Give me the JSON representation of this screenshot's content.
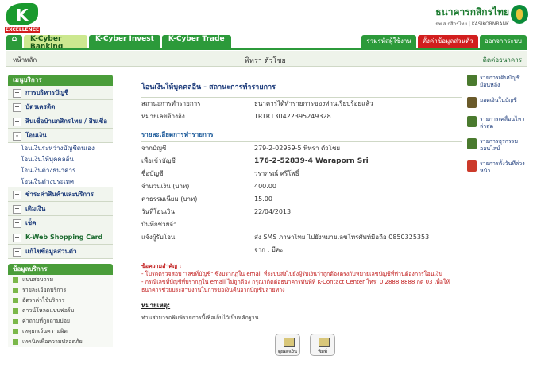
{
  "header": {
    "logo_text": "K",
    "logo_sub": "EXCELLENCE",
    "bank_th": "ธนาคารกสิกรไทย",
    "bank_en": "ธพ.ส.กสิกรไทย | KASIKORNBANK"
  },
  "tabs": [
    {
      "label": "⌂"
    },
    {
      "label": "K-Cyber Banking"
    },
    {
      "label": "K-Cyber Invest"
    },
    {
      "label": "K-Cyber Trade"
    }
  ],
  "rtabs": [
    {
      "label": "รวมรหัสผู้ใช้งาน"
    },
    {
      "label": "ตั้งค่าข้อมูลส่วนตัว"
    },
    {
      "label": "ออกจากระบบ"
    }
  ],
  "subbar": {
    "home": "หน้าหลัก",
    "name": "พิทรา ตัวโชย",
    "contact": "ติดต่อธนาคาร"
  },
  "sidebar": {
    "head": "เมนูบริการ",
    "items": [
      {
        "label": "การบริหารบัญชี"
      },
      {
        "label": "บัตรเครดิต"
      },
      {
        "label": "สินเชื่อบ้านกสิกรไทย / สินเชื่ออื่นๆ"
      },
      {
        "label": "โอนเงิน"
      }
    ],
    "sub": [
      {
        "label": "โอนเงินระหว่างบัญชีตนเอง"
      },
      {
        "label": "โอนเงินให้บุคคลอื่น"
      },
      {
        "label": "โอนเงินต่างธนาคาร"
      },
      {
        "label": "โอนเงินต่างประเทศ"
      }
    ],
    "items2": [
      {
        "label": "ชำระค่าสินค้าและบริการ"
      },
      {
        "label": "เติมเงิน"
      },
      {
        "label": "เช็ค"
      },
      {
        "label": "K-Web Shopping Card"
      },
      {
        "label": "แก้ไขข้อมูลส่วนตัว"
      }
    ],
    "tools_head": "ข้อมูลบริการ",
    "tools": [
      {
        "label": "แบบสอบถาม"
      },
      {
        "label": "รายละเอียดบริการ"
      },
      {
        "label": "อัตราค่าใช้บริการ"
      },
      {
        "label": "ดาวน์โหลดแบบฟอร์ม"
      },
      {
        "label": "คำถามที่ถูกถามบ่อย"
      },
      {
        "label": "เหตุยกเว้นความผิด"
      },
      {
        "label": "เทคนิคเพื่อความปลอดภัย"
      }
    ]
  },
  "main": {
    "title": "โอนเงินให้บุคคลอื่น - สถานะการทำรายการ",
    "status_label": "สถานะการทำรายการ",
    "status_value": "ธนาคารได้ทำรายการของท่านเรียบร้อยแล้ว",
    "ref_label": "หมายเลขอ้างอิง",
    "ref_value": "TRTR130422395249328",
    "detail_head": "รายละเอียดการทำรายการ",
    "rows": [
      {
        "k": "จากบัญชี",
        "v": "279-2-02959-5 พิทรา ตัวโชย"
      },
      {
        "k": "เพื่อเข้าบัญชี",
        "v": "176-2-52839-4 Waraporn    Sri"
      },
      {
        "k": "ชื่อบัญชี",
        "v": "วราภรณ์ ศรีโพธิ์"
      },
      {
        "k": "จำนวนเงิน (บาท)",
        "v": "400.00"
      },
      {
        "k": "ค่าธรรมเนียม (บาท)",
        "v": "15.00"
      },
      {
        "k": "วันที่โอนเงิน",
        "v": "22/04/2013"
      },
      {
        "k": "บันทึกช่วยจำ",
        "v": ""
      },
      {
        "k": "แจ้งผู้รับโอน",
        "v": "ส่ง SMS ภาษาไทย ไปยังหมายเลขโทรศัพท์มือถือ 0850325353"
      },
      {
        "k": "",
        "v": "จาก : บีคะ"
      }
    ],
    "note_head": "ข้อความสำคัญ :",
    "note_1": "- โปรดตรวจสอบ \"เลขที่บัญชี\" ซึ่งปรากฏใน email ที่ระบบส่งไปยังผู้รับเงินว่าถูกต้องตรงกับหมายเลขบัญชีที่ท่านต้องการโอนเงิน",
    "note_2": "- กรณีเลขที่บัญชีที่ปรากฏใน email ไม่ถูกต้อง กรุณาติดต่อธนาคารทันทีที่ K-Contact Center โทร. 0 2888 8888 กด 03 เพื่อให้ธนาคารช่วยประสานงานในการขอเงินคืนจากบัญชีปลายทาง",
    "remark_head": "หมายเหตุ:",
    "remark_text": "ท่านสามารถพิมพ์รายการนี้เพื่อเก็บไว้เป็นหลักฐาน"
  },
  "buttons": {
    "save": "ดูยอดเงิน",
    "print": "พิมพ์"
  },
  "rightcol": [
    {
      "label": "รายการเดินบัญชีย้อนหลัง"
    },
    {
      "label": "ยอดเงินในบัญชี"
    },
    {
      "label": "รายการเคลื่อนไหวล่าสุด"
    },
    {
      "label": "รายการธุรกรรมออนไลน์"
    },
    {
      "label": "รายการตั้งวันที่ล่วงหน้า"
    }
  ]
}
